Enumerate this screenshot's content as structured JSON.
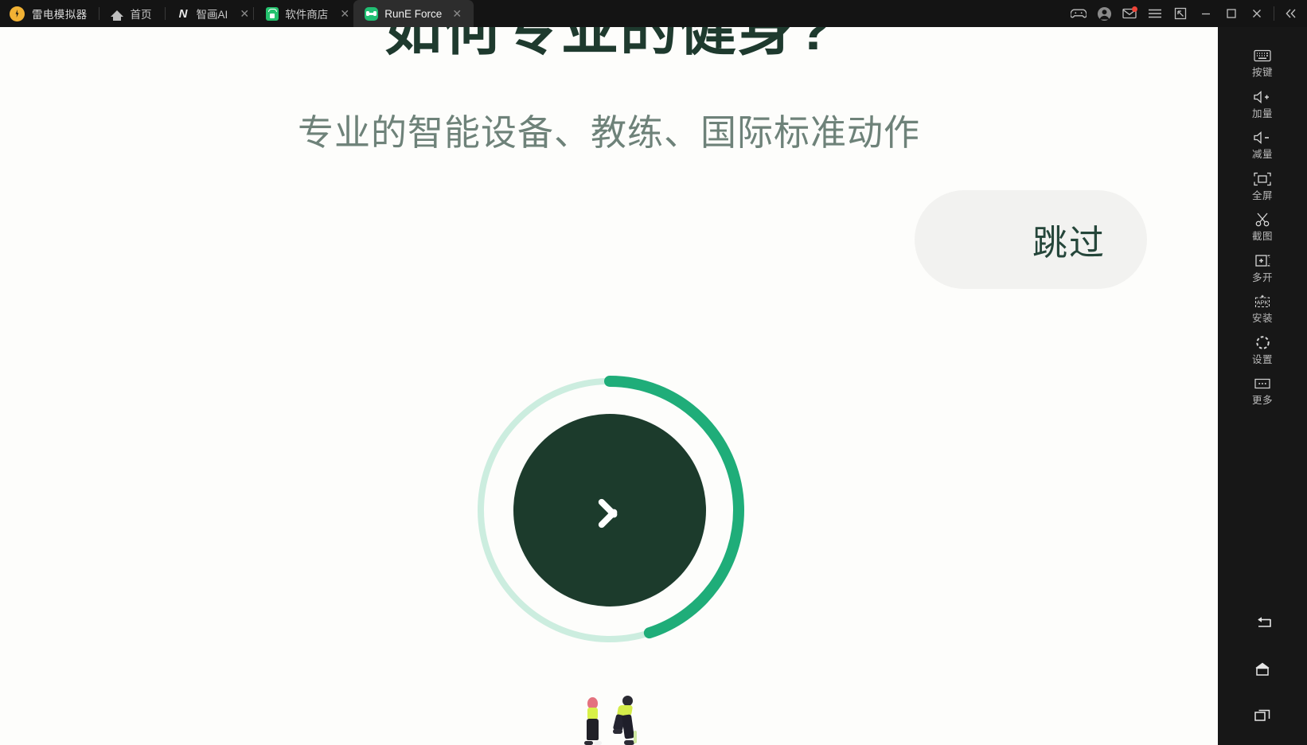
{
  "window": {
    "brand": {
      "label": "雷电模拟器",
      "icon": "ldplayer-logo-icon"
    },
    "tabs": [
      {
        "label": "首页",
        "icon": "home-icon",
        "closable": false,
        "active": false
      },
      {
        "label": "智画AI",
        "icon": "zhihua-ai-icon",
        "closable": true,
        "active": false
      },
      {
        "label": "软件商店",
        "icon": "app-store-icon",
        "closable": true,
        "active": false
      },
      {
        "label": "RunE Force",
        "icon": "rune-force-icon",
        "closable": true,
        "active": true
      }
    ],
    "close_glyph": "✕",
    "controls": [
      {
        "name": "gamepad-icon",
        "label": "手柄"
      },
      {
        "name": "account-avatar-icon",
        "label": "账号"
      },
      {
        "name": "mail-icon",
        "label": "消息",
        "badge": true
      },
      {
        "name": "menu-icon",
        "label": "菜单"
      },
      {
        "name": "resize-icon",
        "label": "调整窗口"
      },
      {
        "name": "minimize-icon",
        "label": "最小化"
      },
      {
        "name": "maximize-icon",
        "label": "最大化"
      },
      {
        "name": "close-icon",
        "label": "关闭"
      },
      {
        "name": "collapse-icon",
        "label": "收起"
      }
    ]
  },
  "content": {
    "title": "如何专业的健身?",
    "subtitle": "专业的智能设备、教练、国际标准动作",
    "skip_label": "跳过",
    "progress": {
      "percent": 45,
      "track_color": "#CCEDDF",
      "arc_color": "#1FAD79",
      "center_color": "#1C3B2C",
      "chevron": "chevron-right-icon"
    },
    "colors": {
      "background": "#FDFDFB",
      "title": "#1E3A2E",
      "subtitle": "#6E8279",
      "skip_bg": "#F2F2F0",
      "skip_text": "#25463A"
    }
  },
  "sidebar": {
    "items": [
      {
        "label": "按键",
        "icon": "keyboard-icon"
      },
      {
        "label": "加量",
        "icon": "volume-up-icon"
      },
      {
        "label": "减量",
        "icon": "volume-down-icon"
      },
      {
        "label": "全屏",
        "icon": "fullscreen-icon"
      },
      {
        "label": "截图",
        "icon": "scissors-screenshot-icon"
      },
      {
        "label": "多开",
        "icon": "multi-instance-icon"
      },
      {
        "label": "安装",
        "icon": "apk-install-icon"
      },
      {
        "label": "设置",
        "icon": "settings-gear-icon"
      },
      {
        "label": "更多",
        "icon": "more-dots-icon"
      }
    ],
    "nav": [
      {
        "name": "android-back-icon",
        "label": "返回"
      },
      {
        "name": "android-home-icon",
        "label": "主页"
      },
      {
        "name": "android-recents-icon",
        "label": "最近任务"
      }
    ]
  }
}
